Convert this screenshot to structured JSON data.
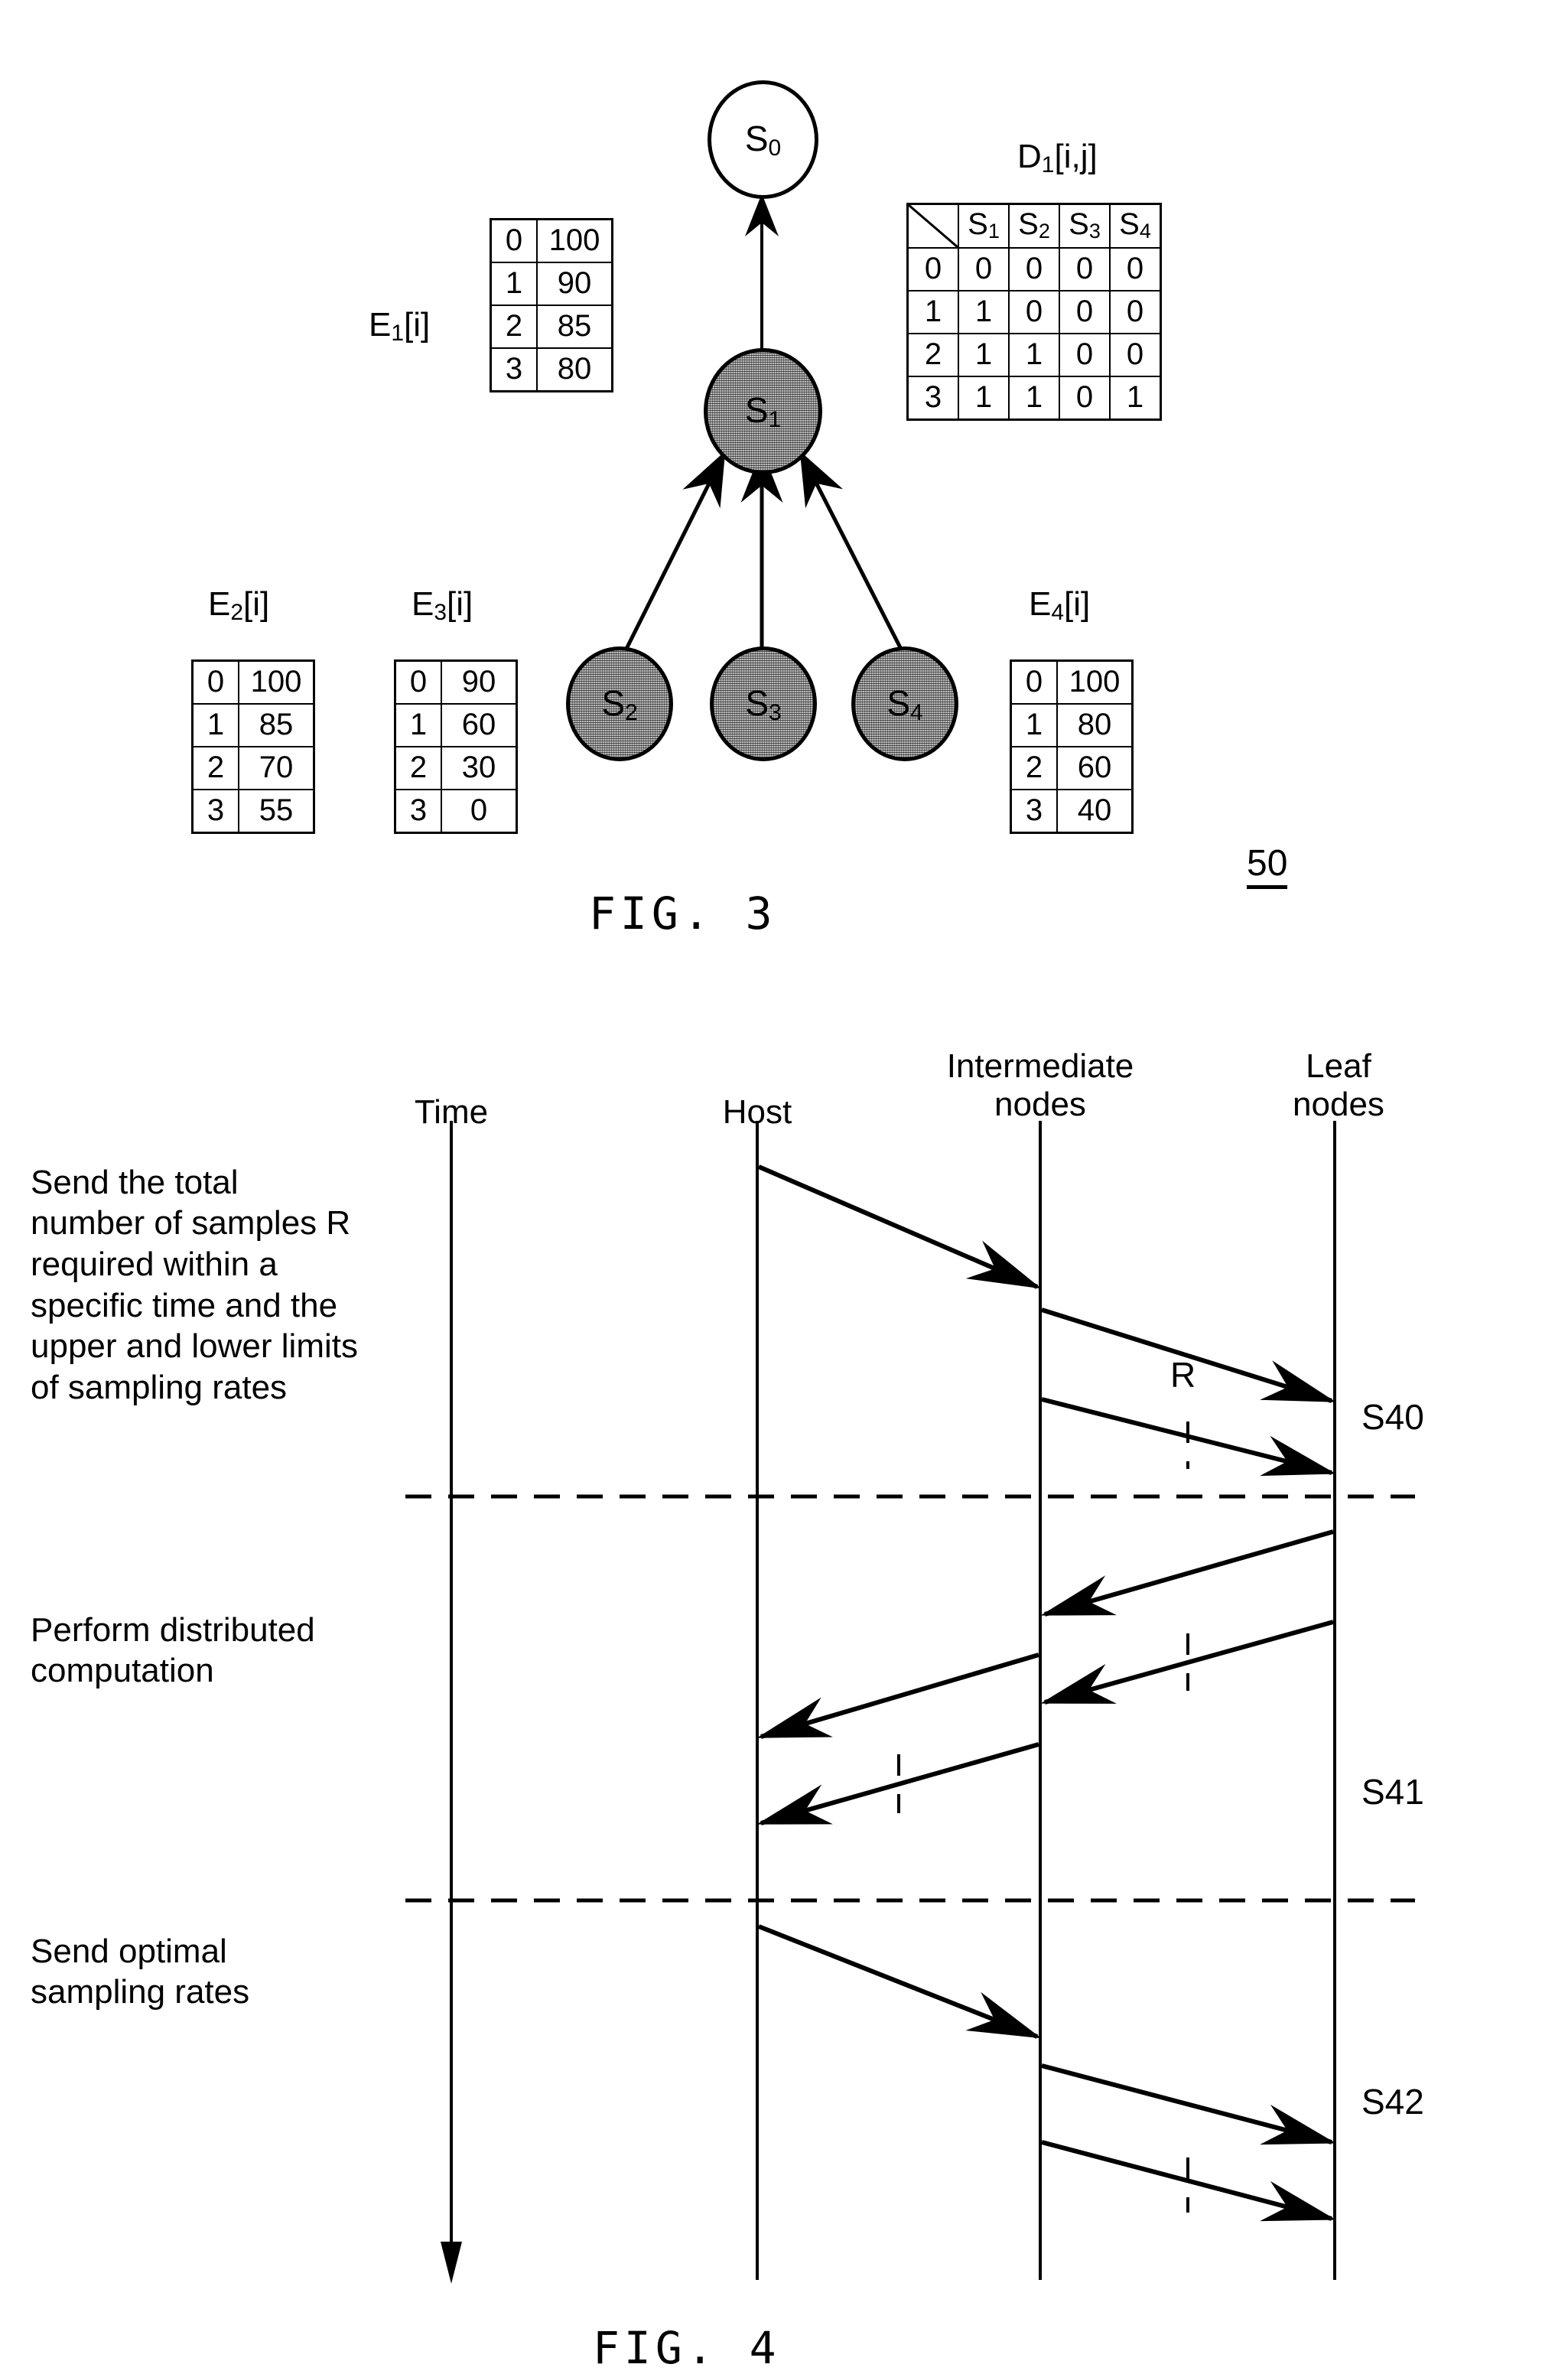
{
  "figure3": {
    "caption": "FIG. 3",
    "ref_number": "50",
    "nodes": [
      {
        "id": "S0",
        "label": "S",
        "sub": "0",
        "style": "white"
      },
      {
        "id": "S1",
        "label": "S",
        "sub": "1",
        "style": "shaded"
      },
      {
        "id": "S2",
        "label": "S",
        "sub": "2",
        "style": "shaded"
      },
      {
        "id": "S3",
        "label": "S",
        "sub": "3",
        "style": "shaded"
      },
      {
        "id": "S4",
        "label": "S",
        "sub": "4",
        "style": "shaded"
      }
    ],
    "tables": {
      "E1": {
        "title_base": "E",
        "title_sub": "1",
        "title_tail": "[i]",
        "keys": [
          "0",
          "1",
          "2",
          "3"
        ],
        "values": [
          "100",
          "90",
          "85",
          "80"
        ]
      },
      "E2": {
        "title_base": "E",
        "title_sub": "2",
        "title_tail": "[i]",
        "keys": [
          "0",
          "1",
          "2",
          "3"
        ],
        "values": [
          "100",
          "85",
          "70",
          "55"
        ]
      },
      "E3": {
        "title_base": "E",
        "title_sub": "3",
        "title_tail": "[i]",
        "keys": [
          "0",
          "1",
          "2",
          "3"
        ],
        "values": [
          "90",
          "60",
          "30",
          "0"
        ]
      },
      "E4": {
        "title_base": "E",
        "title_sub": "4",
        "title_tail": "[i]",
        "keys": [
          "0",
          "1",
          "2",
          "3"
        ],
        "values": [
          "100",
          "80",
          "60",
          "40"
        ]
      },
      "D1": {
        "title_base": "D",
        "title_sub": "1",
        "title_tail": "[i,j]",
        "col_headers": [
          "S1",
          "S2",
          "S3",
          "S4"
        ],
        "col_header_base": [
          "S",
          "S",
          "S",
          "S"
        ],
        "col_header_sub": [
          "1",
          "2",
          "3",
          "4"
        ],
        "row_headers": [
          "0",
          "1",
          "2",
          "3"
        ],
        "rows": [
          [
            "0",
            "0",
            "0",
            "0"
          ],
          [
            "1",
            "0",
            "0",
            "0"
          ],
          [
            "1",
            "1",
            "0",
            "0"
          ],
          [
            "1",
            "1",
            "0",
            "1"
          ]
        ]
      }
    }
  },
  "figure4": {
    "caption": "FIG. 4",
    "column_headers": [
      {
        "name": "time",
        "label": "Time"
      },
      {
        "name": "host",
        "label": "Host"
      },
      {
        "name": "intermediate",
        "label": "Intermediate\nnodes"
      },
      {
        "name": "leaf",
        "label": "Leaf\nnodes"
      }
    ],
    "steps": [
      {
        "id": "S40",
        "description": "Send the total\nnumber of samples R\nrequired within a\nspecific time and the\nupper and lower limits\nof sampling rates"
      },
      {
        "id": "S41",
        "description": "Perform distributed\ncomputation"
      },
      {
        "id": "S42",
        "description": "Send optimal\nsampling rates"
      }
    ],
    "message_labels": [
      {
        "name": "message-R",
        "label": "R"
      }
    ]
  }
}
